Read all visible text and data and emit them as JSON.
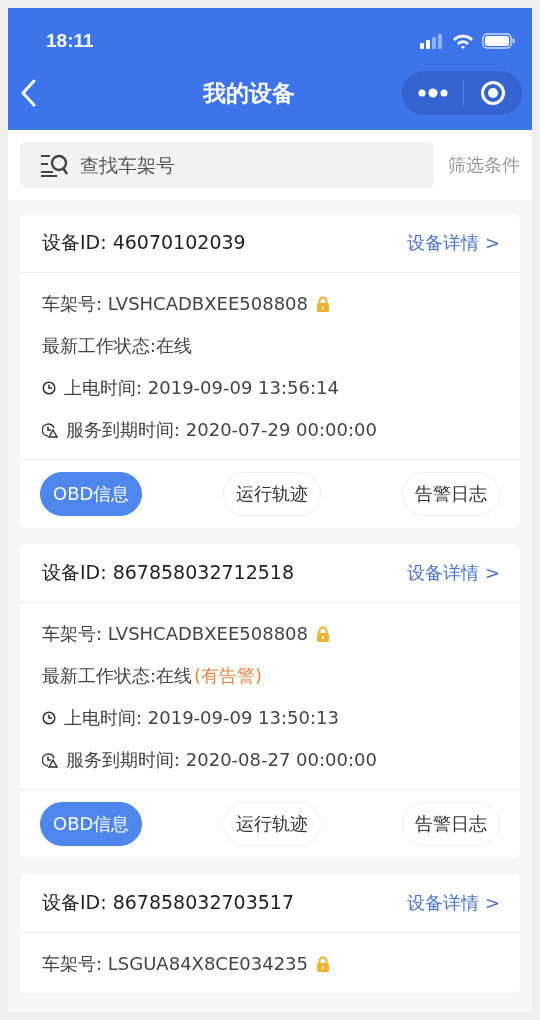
{
  "status_bar": {
    "time": "18:11"
  },
  "nav": {
    "title": "我的设备"
  },
  "search": {
    "placeholder": "查找车架号",
    "filter_label": "筛选条件"
  },
  "devices": [
    {
      "id_label": "设备ID: 46070102039",
      "detail_link": "设备详情 >",
      "vin": "车架号: LVSHCADBXEE508808",
      "status": "最新工作状态:在线",
      "power_time": "上电时间: 2019-09-09 13:56:14",
      "expire_time": "服务到期时间: 2020-07-29 00:00:00",
      "actions": [
        {
          "label": "OBD信息",
          "selected": true
        },
        {
          "label": "运行轨迹",
          "selected": false
        },
        {
          "label": "告警日志",
          "selected": false
        }
      ]
    },
    {
      "id_label": "设备ID: 867858032712518",
      "detail_link": "设备详情 >",
      "vin": "车架号: LVSHCADBXEE508808",
      "status": "最新工作状态:在线",
      "alarm": "(有告警)",
      "power_time": "上电时间: 2019-09-09 13:50:13",
      "expire_time": "服务到期时间: 2020-08-27 00:00:00",
      "actions": [
        {
          "label": "OBD信息",
          "selected": true
        },
        {
          "label": "运行轨迹",
          "selected": false
        },
        {
          "label": "告警日志",
          "selected": false
        }
      ]
    },
    {
      "id_label": "设备ID: 867858032703517",
      "detail_link": "设备详情 >",
      "vin": "车架号: LSGUA84X8CE034235"
    }
  ]
}
